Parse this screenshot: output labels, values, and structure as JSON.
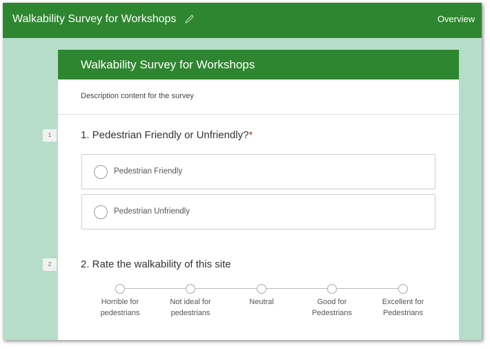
{
  "app": {
    "title": "Walkability Survey for Workshops",
    "overview": "Overview"
  },
  "survey": {
    "title": "Walkability Survey for Workshops",
    "description": "Description content for the survey"
  },
  "q1": {
    "number": "1",
    "title": "1. Pedestrian Friendly or Unfriendly?",
    "required": "*",
    "options": [
      "Pedestrian Friendly",
      "Pedestrian Unfriendly"
    ]
  },
  "q2": {
    "number": "2",
    "title": "2. Rate the walkability of this site",
    "scale": [
      [
        "Horrible for",
        "pedestrians"
      ],
      [
        "Not ideal for",
        "pedestrians"
      ],
      [
        "Neutral",
        ""
      ],
      [
        "Good for",
        "Pedestrians"
      ],
      [
        "Excellent for",
        "Pedestrians"
      ]
    ]
  }
}
